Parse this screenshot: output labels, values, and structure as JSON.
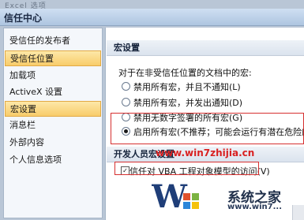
{
  "window": {
    "background_title": "Excel 选项",
    "title": "信任中心"
  },
  "sidebar": {
    "items": [
      {
        "label": "受信任的发布者",
        "selected": false
      },
      {
        "label": "受信任位置",
        "selected": true
      },
      {
        "label": "加载项",
        "selected": false
      },
      {
        "label": "ActiveX 设置",
        "selected": false
      },
      {
        "label": "宏设置",
        "selected": true
      },
      {
        "label": "消息栏",
        "selected": false
      },
      {
        "label": "外部内容",
        "selected": false
      },
      {
        "label": "个人信息选项",
        "selected": false
      }
    ]
  },
  "macro_settings": {
    "heading": "宏设置",
    "description": "对于在非受信任位置的文档中的宏:",
    "options": [
      {
        "label": "禁用所有宏，并且不通知(L)",
        "checked": false
      },
      {
        "label": "禁用所有宏，并发出通知(D)",
        "checked": false
      },
      {
        "label": "禁用无数字签署的所有宏(G)",
        "checked": false
      },
      {
        "label": "启用所有宏(不推荐；可能会运行有潜在危险的代",
        "checked": true
      }
    ]
  },
  "developer_settings": {
    "heading": "开发人员宏设置",
    "checkbox_label": "信任对 VBA 工程对象模型的访问(V)",
    "checked": true
  },
  "watermark": {
    "url": "www.win7zhijia.cn",
    "logo_text": "系统之家",
    "logo_site": "www.win7..."
  },
  "colors": {
    "selection": "#f8cc6a",
    "highlight_box": "#d63030",
    "watermark": "#d92020"
  }
}
